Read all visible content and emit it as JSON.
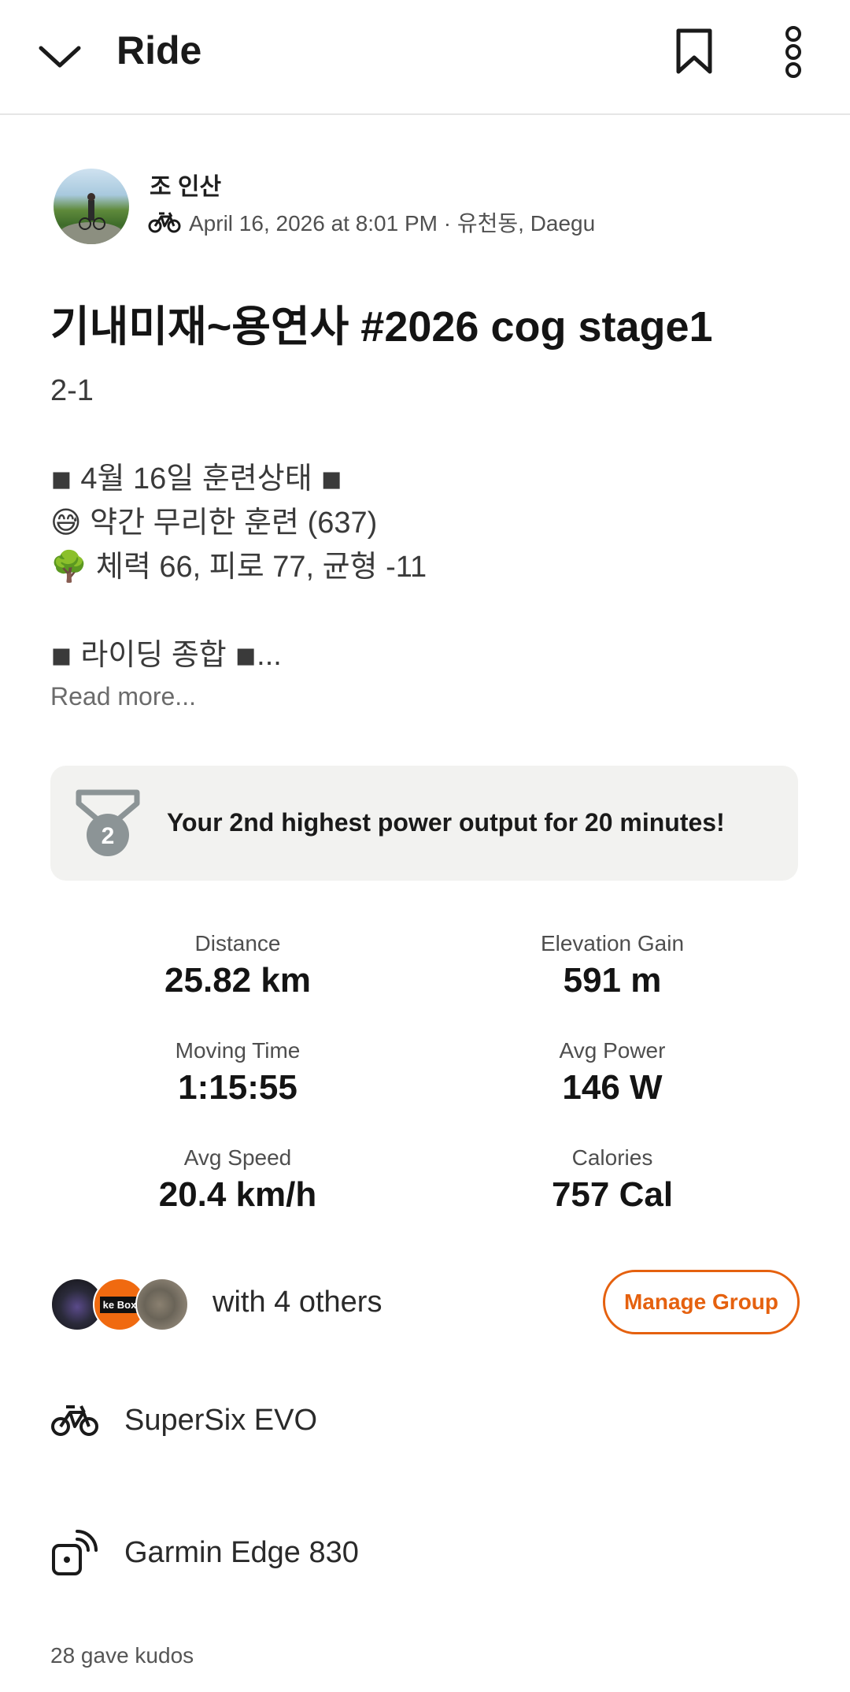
{
  "topbar": {
    "title": "Ride"
  },
  "athlete": {
    "name": "조 인산",
    "meta": "April 16, 2026 at 8:01 PM · 유천동, Daegu"
  },
  "activity": {
    "title": "기내미재~용연사 #2026 cog stage1",
    "description_lines": [
      "2-1",
      "",
      "◾ 4월 16일 훈련상태 ◾",
      "😅 약간 무리한 훈련 (637)",
      "🌳 체력 66, 피로 77, 균형 -11",
      "",
      "◾ 라이딩 종합 ◾..."
    ],
    "read_more": "Read more..."
  },
  "achievement": {
    "rank": "2",
    "text": "Your 2nd highest power output for 20 minutes!"
  },
  "stats": [
    {
      "label": "Distance",
      "value": "25.82 km"
    },
    {
      "label": "Elevation Gain",
      "value": "591 m"
    },
    {
      "label": "Moving Time",
      "value": "1:15:55"
    },
    {
      "label": "Avg Power",
      "value": "146 W"
    },
    {
      "label": "Avg Speed",
      "value": "20.4 km/h"
    },
    {
      "label": "Calories",
      "value": "757 Cal"
    }
  ],
  "group": {
    "avatar2_tag": "ke Box",
    "text": "with 4 others",
    "button": "Manage Group"
  },
  "gear": {
    "bike": "SuperSix EVO",
    "device": "Garmin Edge 830"
  },
  "kudos": "28 gave kudos",
  "colors": {
    "accent": "#e5610f",
    "achievement_bg": "#f2f2f0",
    "medal": "#8c9496"
  }
}
